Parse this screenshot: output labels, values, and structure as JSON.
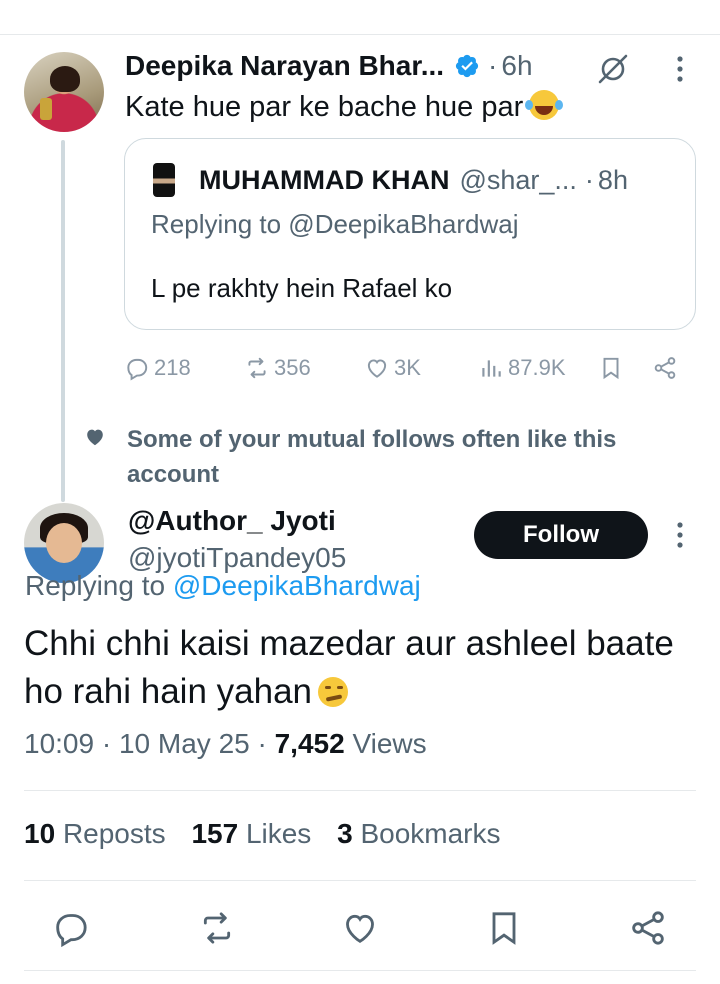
{
  "parent": {
    "name": "Deepika Narayan Bhar...",
    "separator": "·",
    "time": "6h",
    "text": "Kate hue par ke bache hue par",
    "emoji": "face-with-tears-of-joy",
    "verified_color": "#1d9bf0",
    "quote": {
      "name": "MUHAMMAD KHAN",
      "handle": "@shar_...",
      "separator": "·",
      "time": "8h",
      "replying": "Replying to @DeepikaBhardwaj",
      "text": "L pe rakhty hein Rafael ko"
    },
    "actions": {
      "replies": "218",
      "reposts": "356",
      "likes": "3K",
      "views": "87.9K"
    }
  },
  "social_context": "Some of your mutual follows often like this account",
  "main": {
    "name": "@Author_ Jyoti",
    "handle": "@jyotiTpandey05",
    "follow_label": "Follow",
    "replying_prefix": "Replying to",
    "replying_handle": "@DeepikaBhardwaj",
    "text": "Chhi chhi kaisi mazedar aur ashleel baate ho rahi hain yahan",
    "emoji": "smirking-face",
    "time": "10:09",
    "date": "10 May 25",
    "views_count": "7,452",
    "views_label": "Views",
    "sep": "·"
  },
  "stats": {
    "reposts_count": "10",
    "reposts_label": "Reposts",
    "likes_count": "157",
    "likes_label": "Likes",
    "bookmarks_count": "3",
    "bookmarks_label": "Bookmarks"
  },
  "colors": {
    "accent": "#1d9bf0",
    "text": "#0f1419",
    "muted": "#536471",
    "border": "#cfd9de"
  }
}
